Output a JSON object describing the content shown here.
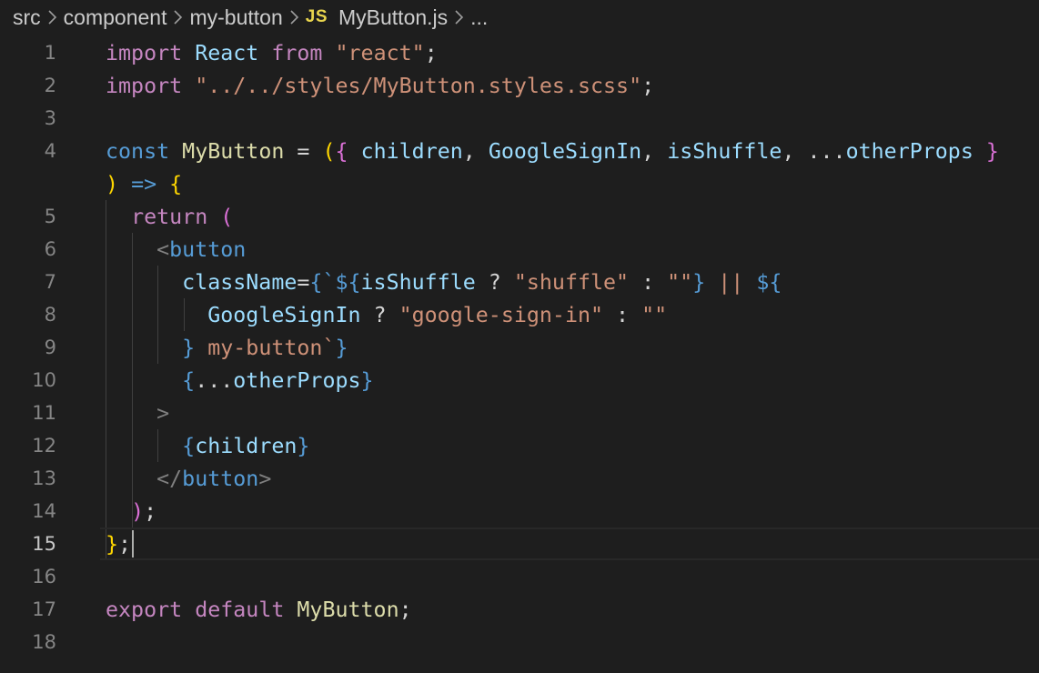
{
  "breadcrumb": {
    "items": [
      "src",
      "component",
      "my-button"
    ],
    "file_badge": "JS",
    "file_name": "MyButton.js",
    "more": "..."
  },
  "editor": {
    "active_line": 15,
    "lines": [
      {
        "n": "1",
        "tokens": [
          [
            "kw",
            "import"
          ],
          [
            "pun",
            " "
          ],
          [
            "vr",
            "React"
          ],
          [
            "pun",
            " "
          ],
          [
            "kw",
            "from"
          ],
          [
            "pun",
            " "
          ],
          [
            "str",
            "\"react\""
          ],
          [
            "pun",
            ";"
          ]
        ]
      },
      {
        "n": "2",
        "tokens": [
          [
            "kw",
            "import"
          ],
          [
            "pun",
            " "
          ],
          [
            "str",
            "\"../../styles/MyButton.styles.scss\""
          ],
          [
            "pun",
            ";"
          ]
        ]
      },
      {
        "n": "3",
        "tokens": []
      },
      {
        "n": "4",
        "tokens": [
          [
            "st",
            "const"
          ],
          [
            "pun",
            " "
          ],
          [
            "fn",
            "MyButton"
          ],
          [
            "pun",
            " = "
          ],
          [
            "br1",
            "("
          ],
          [
            "br2",
            "{"
          ],
          [
            "pun",
            " "
          ],
          [
            "vr",
            "children"
          ],
          [
            "pun",
            ", "
          ],
          [
            "vr",
            "GoogleSignIn"
          ],
          [
            "pun",
            ", "
          ],
          [
            "vr",
            "isShuffle"
          ],
          [
            "pun",
            ", ..."
          ],
          [
            "vr",
            "otherProps"
          ],
          [
            "pun",
            " "
          ],
          [
            "br2",
            "}"
          ]
        ]
      },
      {
        "n": "",
        "tokens": [
          [
            "br1",
            ")"
          ],
          [
            "pun",
            " "
          ],
          [
            "st",
            "=>"
          ],
          [
            "pun",
            " "
          ],
          [
            "br1",
            "{"
          ]
        ]
      },
      {
        "n": "5",
        "tokens": [
          [
            "pun",
            "  "
          ],
          [
            "kw",
            "return"
          ],
          [
            "pun",
            " "
          ],
          [
            "br2",
            "("
          ]
        ]
      },
      {
        "n": "6",
        "tokens": [
          [
            "pun",
            "    "
          ],
          [
            "ang",
            "<"
          ],
          [
            "tag",
            "button"
          ]
        ]
      },
      {
        "n": "7",
        "tokens": [
          [
            "pun",
            "      "
          ],
          [
            "vr",
            "className"
          ],
          [
            "pun",
            "="
          ],
          [
            "tpl",
            "{`${"
          ],
          [
            "vr",
            "isShuffle"
          ],
          [
            "pun",
            " ? "
          ],
          [
            "str",
            "\"shuffle\""
          ],
          [
            "pun",
            " : "
          ],
          [
            "str",
            "\"\""
          ],
          [
            "tpl",
            "}"
          ],
          [
            "str",
            " || "
          ],
          [
            "tpl",
            "${"
          ]
        ]
      },
      {
        "n": "8",
        "tokens": [
          [
            "pun",
            "        "
          ],
          [
            "vr",
            "GoogleSignIn"
          ],
          [
            "pun",
            " ? "
          ],
          [
            "str",
            "\"google-sign-in\""
          ],
          [
            "pun",
            " : "
          ],
          [
            "str",
            "\"\""
          ]
        ]
      },
      {
        "n": "9",
        "tokens": [
          [
            "pun",
            "      "
          ],
          [
            "tpl",
            "}"
          ],
          [
            "str",
            " my-button`"
          ],
          [
            "tpl",
            "}"
          ]
        ]
      },
      {
        "n": "10",
        "tokens": [
          [
            "pun",
            "      "
          ],
          [
            "tpl",
            "{"
          ],
          [
            "pun",
            "..."
          ],
          [
            "vr",
            "otherProps"
          ],
          [
            "tpl",
            "}"
          ]
        ]
      },
      {
        "n": "11",
        "tokens": [
          [
            "pun",
            "    "
          ],
          [
            "ang",
            ">"
          ]
        ]
      },
      {
        "n": "12",
        "tokens": [
          [
            "pun",
            "      "
          ],
          [
            "tpl",
            "{"
          ],
          [
            "vr",
            "children"
          ],
          [
            "tpl",
            "}"
          ]
        ]
      },
      {
        "n": "13",
        "tokens": [
          [
            "pun",
            "    "
          ],
          [
            "ang",
            "</"
          ],
          [
            "tag",
            "button"
          ],
          [
            "ang",
            ">"
          ]
        ]
      },
      {
        "n": "14",
        "tokens": [
          [
            "pun",
            "  "
          ],
          [
            "br2",
            ")"
          ],
          [
            "pun",
            ";"
          ]
        ]
      },
      {
        "n": "15",
        "tokens": [
          [
            "br1",
            "}"
          ],
          [
            "pun",
            ";"
          ]
        ]
      },
      {
        "n": "16",
        "tokens": []
      },
      {
        "n": "17",
        "tokens": [
          [
            "kw",
            "export"
          ],
          [
            "pun",
            " "
          ],
          [
            "kw",
            "default"
          ],
          [
            "pun",
            " "
          ],
          [
            "fn",
            "MyButton"
          ],
          [
            "pun",
            ";"
          ]
        ]
      },
      {
        "n": "18",
        "tokens": []
      }
    ]
  }
}
